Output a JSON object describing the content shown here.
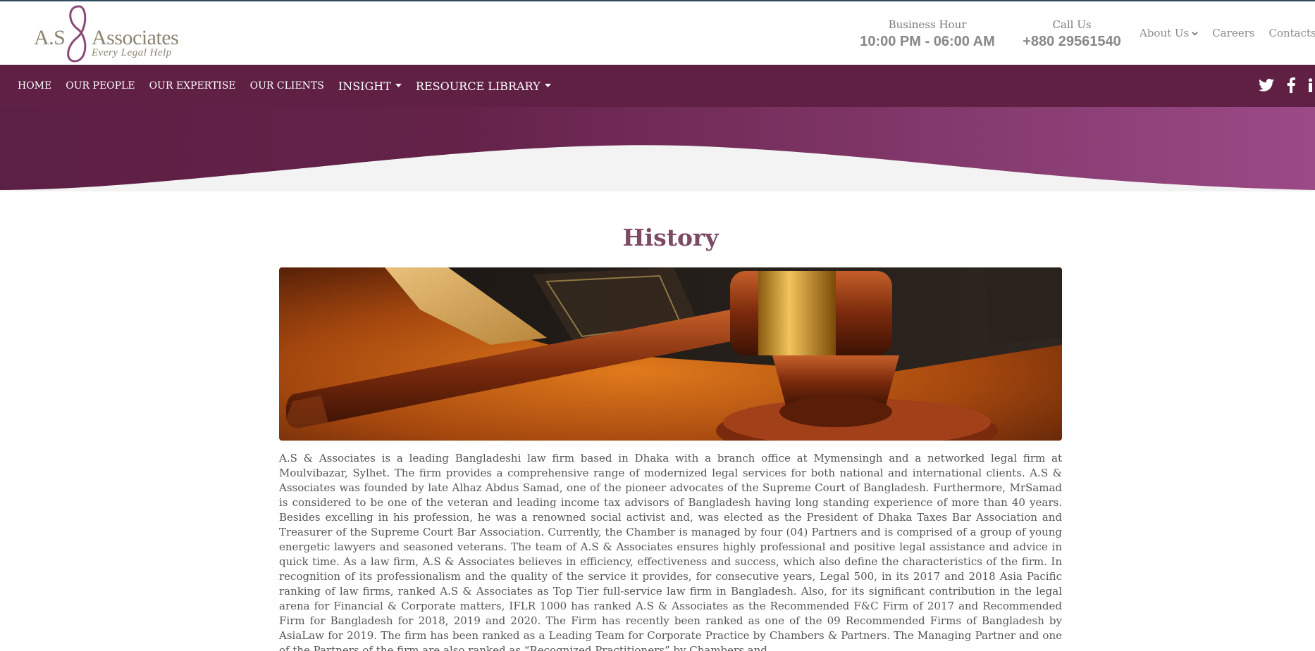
{
  "header": {
    "logo": {
      "text_left": "A.S",
      "text_right": "Associates",
      "tagline": "Every Legal Help"
    },
    "business_hour": {
      "label": "Business Hour",
      "value": "10:00 PM - 06:00 AM"
    },
    "call_us": {
      "label": "Call Us",
      "value": "+880 29561540"
    },
    "top_links": [
      {
        "label": "About Us",
        "has_dropdown": true
      },
      {
        "label": "Careers"
      },
      {
        "label": "Contacts"
      }
    ]
  },
  "nav": {
    "items": [
      {
        "label": "HOME"
      },
      {
        "label": "OUR PEOPLE"
      },
      {
        "label": "OUR EXPERTISE"
      },
      {
        "label": "OUR CLIENTS"
      },
      {
        "label": "INSIGHT",
        "has_dropdown": true
      },
      {
        "label": "RESOURCE LIBRARY",
        "has_dropdown": true
      }
    ],
    "social_icons": [
      "twitter-icon",
      "facebook-icon",
      "linkedin-icon"
    ]
  },
  "colors": {
    "nav_bg": "#5f2043",
    "hero_start": "#5c1f45",
    "hero_end": "#9b4a86",
    "title": "#7c4a62"
  },
  "main": {
    "title": "History",
    "image": "gavel-and-law-book-photo",
    "body": "A.S & Associates is a leading Bangladeshi law firm based in Dhaka with a branch office at Mymensingh and a networked legal firm at Moulvibazar, Sylhet. The firm provides a comprehensive range of modernized legal services for both national and international clients. A.S & Associates was founded by late Alhaz Abdus Samad, one of the pioneer advocates of the Supreme Court of Bangladesh. Furthermore, MrSamad is considered to be one of the veteran and leading income tax advisors of Bangladesh having long standing experience of more than 40 years. Besides excelling in his profession, he was a renowned social activist and, was elected as the President of Dhaka Taxes Bar Association and Treasurer of the Supreme Court Bar Association. Currently, the Chamber is managed by four (04) Partners and is comprised of a group of young energetic lawyers and seasoned veterans. The team of A.S & Associates ensures highly professional and positive legal assistance and advice in quick time. As a law firm, A.S & Associates believes in efficiency, effectiveness and success, which also define the characteristics of the firm. In recognition of its professionalism and the quality of the service it provides, for consecutive years, Legal 500, in its 2017 and 2018 Asia Pacific ranking of law firms, ranked A.S & Associates as Top Tier full-service law firm in Bangladesh. Also, for its significant contribution in the legal arena for Financial & Corporate matters, IFLR 1000 has ranked A.S & Associates as the Recommended F&C Firm of 2017 and Recommended Firm for Bangladesh for 2018, 2019 and 2020. The Firm has recently been ranked as one of the 09 Recommended Firms of Bangladesh by AsiaLaw for 2019. The firm has been ranked as a Leading Team for Corporate Practice by Chambers & Partners. The Managing Partner and one of the Partners of the firm are also ranked as “Recognized Practitioners” by Chambers and"
  }
}
